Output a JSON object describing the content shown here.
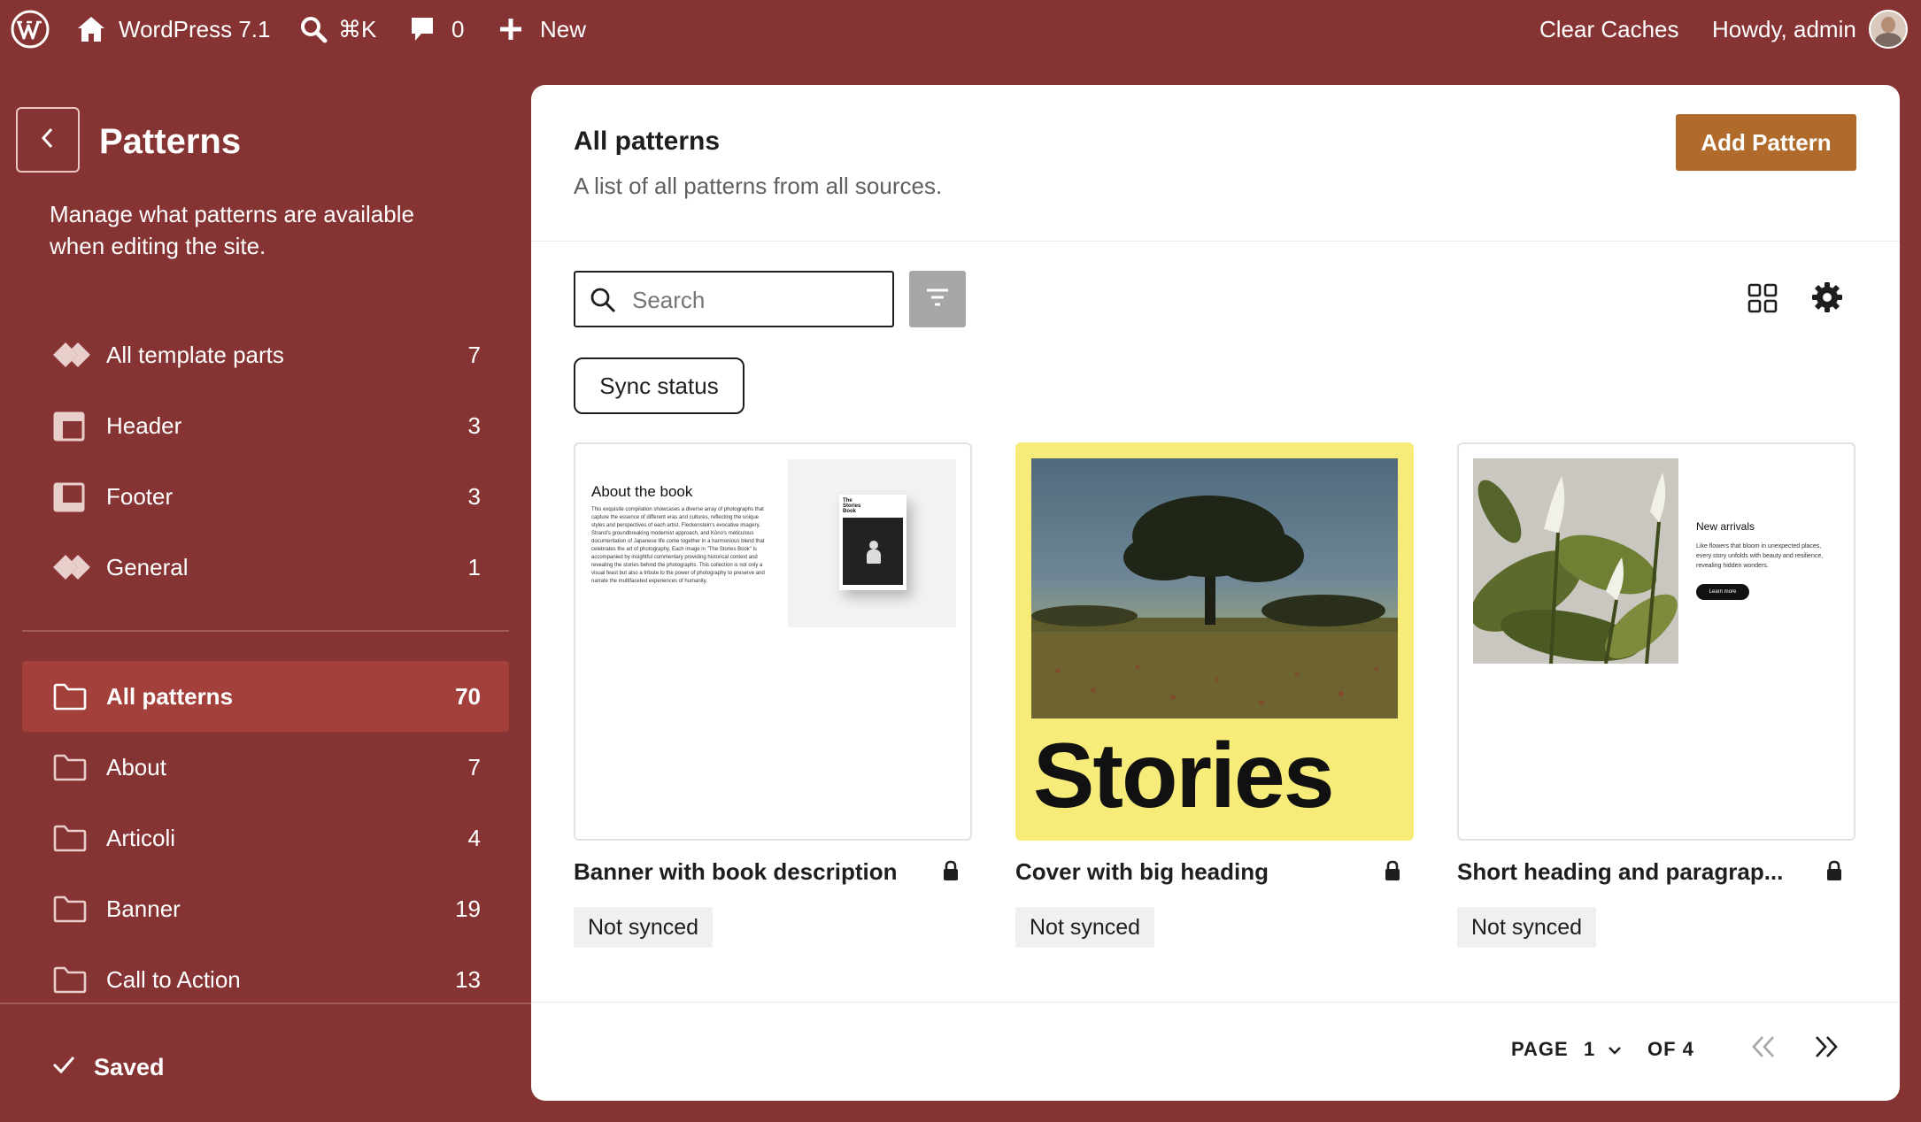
{
  "admin_bar": {
    "site_name": "WordPress 7.1",
    "search_shortcut": "⌘K",
    "comments_count": "0",
    "new_label": "New",
    "clear_caches": "Clear Caches",
    "howdy": "Howdy, admin"
  },
  "sidebar": {
    "title": "Patterns",
    "description": "Manage what patterns are available when editing the site.",
    "template_parts": [
      {
        "label": "All template parts",
        "count": "7",
        "icon": "diamond-icon"
      },
      {
        "label": "Header",
        "count": "3",
        "icon": "header-layout-icon"
      },
      {
        "label": "Footer",
        "count": "3",
        "icon": "footer-layout-icon"
      },
      {
        "label": "General",
        "count": "1",
        "icon": "diamond-icon"
      }
    ],
    "categories": [
      {
        "label": "All patterns",
        "count": "70",
        "active": true,
        "icon": "folder-icon"
      },
      {
        "label": "About",
        "count": "7",
        "icon": "folder-icon"
      },
      {
        "label": "Articoli",
        "count": "4",
        "icon": "folder-icon"
      },
      {
        "label": "Banner",
        "count": "19",
        "icon": "folder-icon"
      },
      {
        "label": "Call to Action",
        "count": "13",
        "icon": "folder-icon"
      }
    ],
    "saved_label": "Saved"
  },
  "main": {
    "title": "All patterns",
    "subtitle": "A list of all patterns from all sources.",
    "add_button": "Add Pattern",
    "search_placeholder": "Search",
    "sync_status": "Sync status",
    "cards": [
      {
        "title": "Banner with book description",
        "badge": "Not synced",
        "preview": {
          "heading": "About the book",
          "body": "This exquisite compilation showcases a diverse array of photographs that capture the essence of different eras and cultures, reflecting the unique styles and perspectives of each artist. Fleckenstein's evocative imagery, Strand's groundbreaking modernist approach, and Kōno's meticulous documentation of Japanese life come together in a harmonious blend that celebrates the art of photography. Each image in \"The Stories Book\" is accompanied by insightful commentary providing historical context and revealing the stories behind the photographs. This collection is not only a visual feast but also a tribute to the power of photography to preserve and narrate the multifaceted experiences of humanity.",
          "book_title": "The Stories Book"
        }
      },
      {
        "title": "Cover with big heading",
        "badge": "Not synced",
        "preview": {
          "heading": "Stories"
        }
      },
      {
        "title": "Short heading and paragrap...",
        "badge": "Not synced",
        "preview": {
          "heading": "New arrivals",
          "body": "Like flowers that bloom in unexpected places, every story unfolds with beauty and resilience, revealing hidden wonders.",
          "button": "Learn more"
        }
      }
    ],
    "pagination": {
      "page_label": "PAGE",
      "current": "1",
      "of_label": "OF 4"
    }
  },
  "colors": {
    "admin_bg": "#863333",
    "active_nav": "#a4403b",
    "accent": "#b06a2c",
    "cover_yellow": "#f7ec7a"
  }
}
